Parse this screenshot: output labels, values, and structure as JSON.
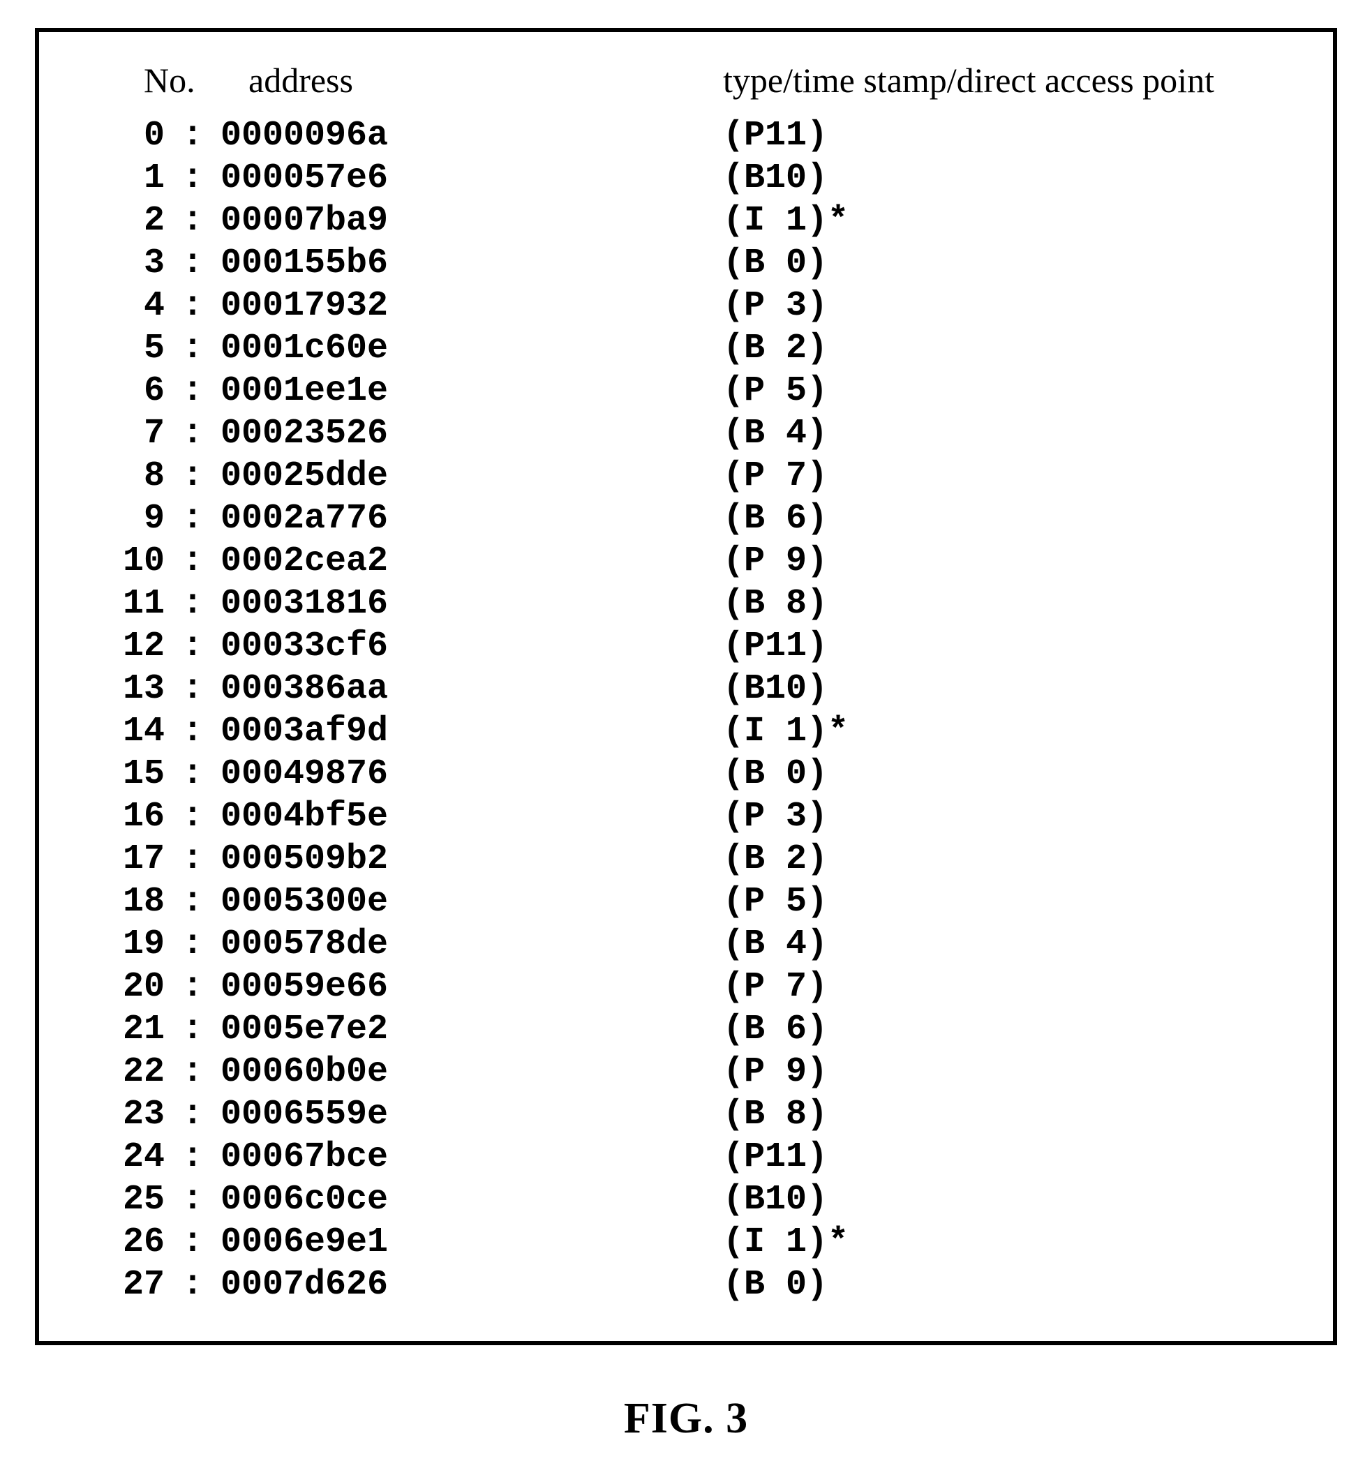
{
  "headers": {
    "no": "No.",
    "address": "address",
    "info": "type/time stamp/direct access point"
  },
  "rows": [
    {
      "no": "0",
      "address": "0000096a",
      "info": "(P11)"
    },
    {
      "no": "1",
      "address": "000057e6",
      "info": "(B10)"
    },
    {
      "no": "2",
      "address": "00007ba9",
      "info": "(I 1)*"
    },
    {
      "no": "3",
      "address": "000155b6",
      "info": "(B 0)"
    },
    {
      "no": "4",
      "address": "00017932",
      "info": "(P 3)"
    },
    {
      "no": "5",
      "address": "0001c60e",
      "info": "(B 2)"
    },
    {
      "no": "6",
      "address": "0001ee1e",
      "info": "(P 5)"
    },
    {
      "no": "7",
      "address": "00023526",
      "info": "(B 4)"
    },
    {
      "no": "8",
      "address": "00025dde",
      "info": "(P 7)"
    },
    {
      "no": "9",
      "address": "0002a776",
      "info": "(B 6)"
    },
    {
      "no": "10",
      "address": "0002cea2",
      "info": "(P 9)"
    },
    {
      "no": "11",
      "address": "00031816",
      "info": "(B 8)"
    },
    {
      "no": "12",
      "address": "00033cf6",
      "info": "(P11)"
    },
    {
      "no": "13",
      "address": "000386aa",
      "info": "(B10)"
    },
    {
      "no": "14",
      "address": "0003af9d",
      "info": "(I 1)*"
    },
    {
      "no": "15",
      "address": "00049876",
      "info": "(B 0)"
    },
    {
      "no": "16",
      "address": "0004bf5e",
      "info": "(P 3)"
    },
    {
      "no": "17",
      "address": "000509b2",
      "info": "(B 2)"
    },
    {
      "no": "18",
      "address": "0005300e",
      "info": "(P 5)"
    },
    {
      "no": "19",
      "address": "000578de",
      "info": "(B 4)"
    },
    {
      "no": "20",
      "address": "00059e66",
      "info": "(P 7)"
    },
    {
      "no": "21",
      "address": "0005e7e2",
      "info": "(B 6)"
    },
    {
      "no": "22",
      "address": "00060b0e",
      "info": "(P 9)"
    },
    {
      "no": "23",
      "address": "0006559e",
      "info": "(B 8)"
    },
    {
      "no": "24",
      "address": "00067bce",
      "info": "(P11)"
    },
    {
      "no": "25",
      "address": "0006c0ce",
      "info": "(B10)"
    },
    {
      "no": "26",
      "address": "0006e9e1",
      "info": "(I 1)*"
    },
    {
      "no": "27",
      "address": "0007d626",
      "info": "(B 0)"
    }
  ],
  "caption": "FIG. 3"
}
